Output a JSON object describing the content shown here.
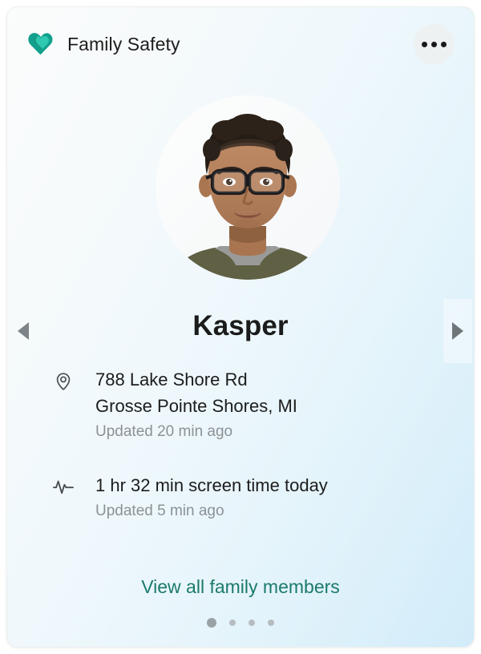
{
  "header": {
    "title": "Family Safety",
    "logo_icon": "family-safety-heart-icon",
    "logo_color_outer": "#0f7a6e",
    "logo_color_mid": "#13a08f",
    "logo_color_inner": "#2ec4ad",
    "more_options_icon": "ellipsis-icon",
    "more_options_label": "More options"
  },
  "member": {
    "name": "Kasper",
    "avatar_icon": "member-photo",
    "avatar_alt": "Photo of a teenage boy with glasses"
  },
  "details": [
    {
      "icon": "location-pin-icon",
      "primary_line_1": "788 Lake Shore Rd",
      "primary_line_2": "Grosse Pointe Shores, MI",
      "secondary": "Updated 20 min ago"
    },
    {
      "icon": "pulse-activity-icon",
      "primary_line_1": "1 hr 32 min screen time today",
      "secondary": "Updated 5 min ago"
    }
  ],
  "footer": {
    "view_all_label": "View all family members",
    "link_color": "#1b7a6b"
  },
  "carousel": {
    "prev_icon": "chevron-left-icon",
    "next_icon": "chevron-right-icon",
    "total_pages": 4,
    "active_page": 1
  },
  "theme": {
    "card_background_start": "#fbfcfc",
    "card_background_end": "#d2ecf9",
    "text_primary": "#1c1c1c",
    "text_secondary": "#8c9194"
  }
}
